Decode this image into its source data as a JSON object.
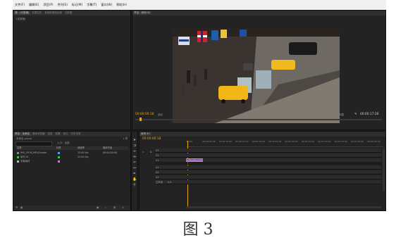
{
  "menu": [
    "文件(F)",
    "编辑(E)",
    "项目(P)",
    "序列(S)",
    "标记(M)",
    "字幕(T)",
    "窗口(W)",
    "帮助(H)"
  ],
  "source_panel": {
    "tabs": [
      "源：(无剪辑)",
      "效果控件",
      "音频剪辑混合器",
      "元数据"
    ],
    "body_text": "(无剪辑)"
  },
  "program_panel": {
    "tab": "节目：序列 01",
    "timecode_left": "00:00:00:18",
    "fit_label": "适合",
    "quality_label": "完整",
    "timecode_right": "00:00:17:28",
    "transport_icons": [
      "marker-icon",
      "in-point-icon",
      "out-point-icon",
      "go-to-in-icon",
      "step-back-icon",
      "play-icon",
      "step-forward-icon",
      "go-to-out-icon",
      "lift-icon",
      "extract-icon",
      "export-frame-icon"
    ],
    "transport_glyphs": [
      "▾",
      "{",
      "}",
      "|◀",
      "◀|",
      "▶",
      "|▶",
      "▶|",
      "⇡",
      "⇣",
      "◙"
    ]
  },
  "project_panel": {
    "tabs": [
      "项目：未命名",
      "媒体浏览器",
      "信息",
      "效果",
      "标记",
      "历史记录"
    ],
    "project_file": "未命名.prproj",
    "item_count": "1 项",
    "search_placeholder": "入口：全部",
    "columns": [
      "名称",
      "标签",
      "帧速率",
      "媒体开始"
    ],
    "items": [
      {
        "name": "IMG_5976_MP4Grande",
        "label_color": "#4aa3df",
        "fps": "25.00 fps",
        "start": "00:00:00:00"
      },
      {
        "name": "序列 01",
        "label_color": "#3ec43e",
        "fps": "25.00 fps",
        "start": ""
      },
      {
        "name": "字幕素材",
        "label_color": "#c77bd8",
        "fps": "",
        "start": ""
      }
    ]
  },
  "timeline_panel": {
    "tab": "序列 01",
    "timecode": "00:00:00:18",
    "ruler_ticks": [
      "00:00",
      "00:00:05:00",
      "00:00:10:00",
      "00:00:15:00",
      "00:00:20:00",
      "00:00:25:00",
      "00:00:30:00",
      "00:00:35:00",
      "00:00:40:00",
      "00:00:45:00",
      "00:00:50:00",
      "00:00:55:00"
    ],
    "video_tracks": [
      "V3",
      "V2",
      "V1"
    ],
    "audio_tracks": [
      "A1",
      "A2",
      "A3"
    ],
    "master_label": "主声道",
    "master_value": "0.0",
    "clip_label": "IMG_5976_MP4Grande",
    "clip_color": "#b77fd2"
  },
  "caption": "图 3"
}
